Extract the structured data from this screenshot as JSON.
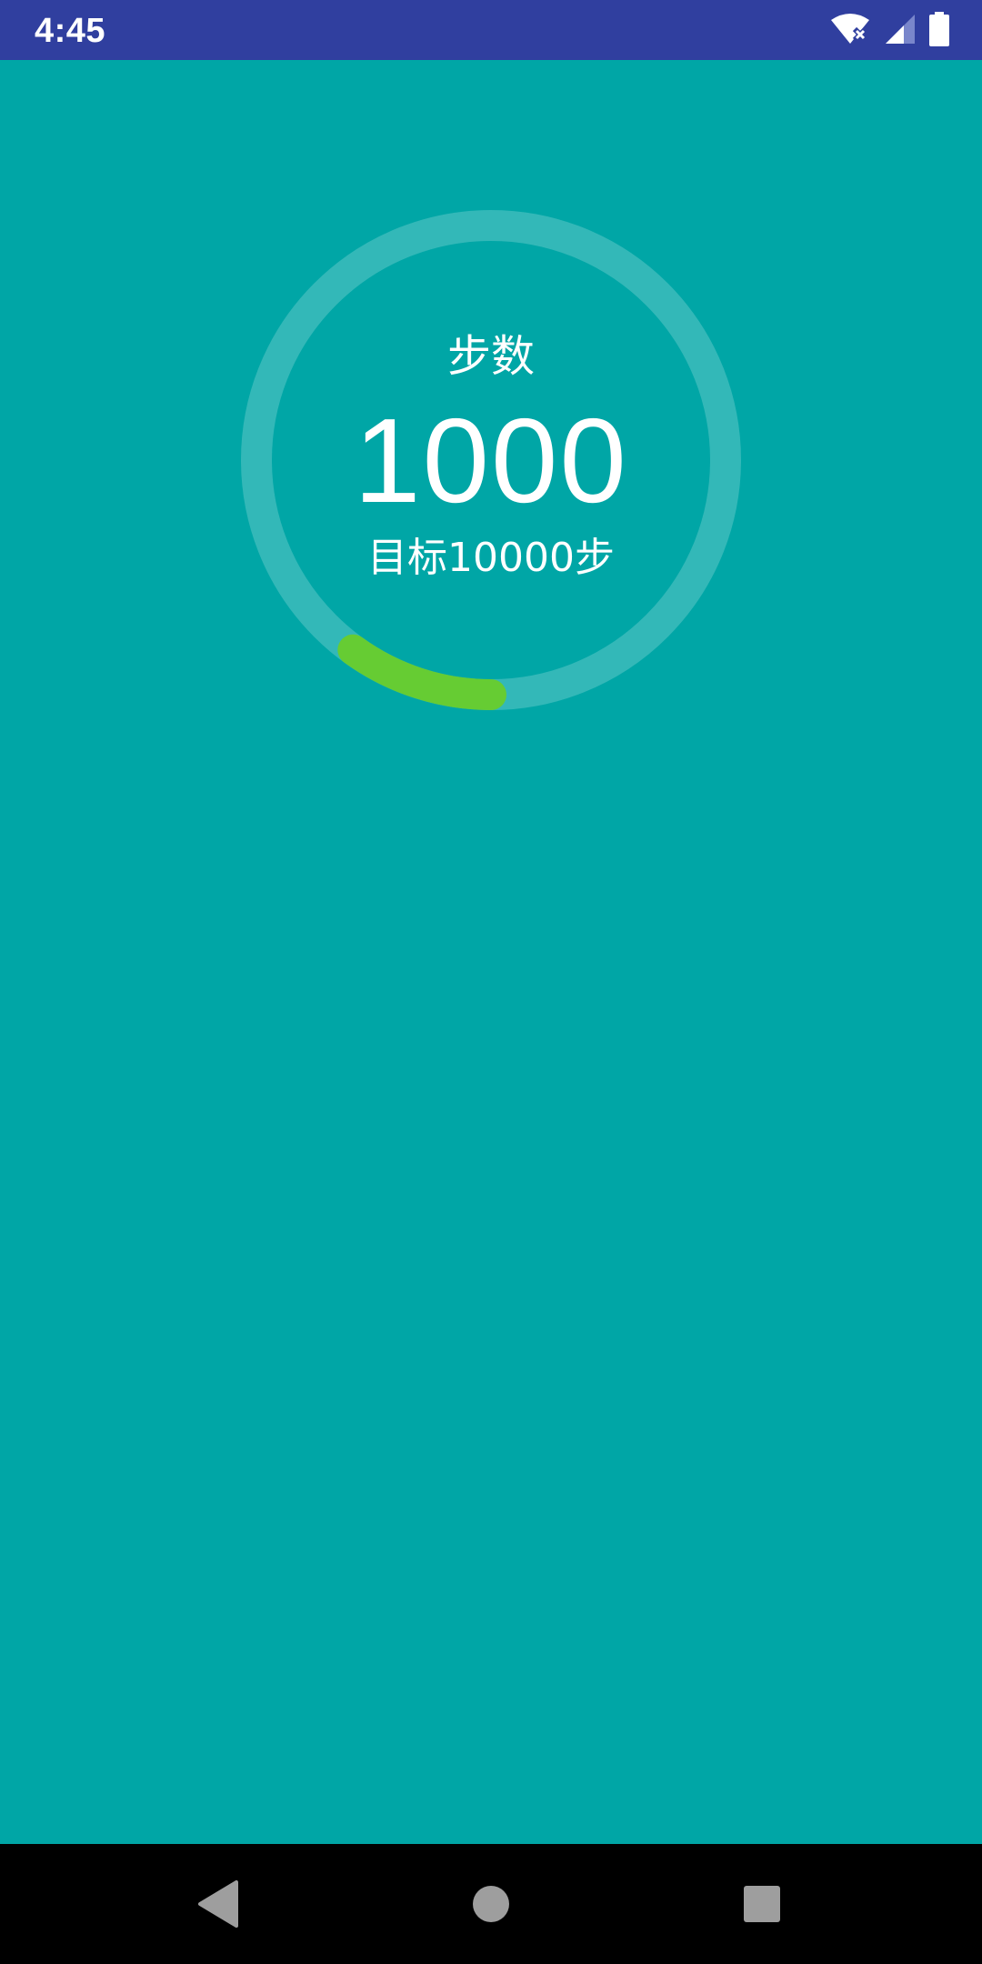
{
  "status_bar": {
    "time": "4:45",
    "icons": [
      "wifi-off-icon",
      "cellular-signal-icon",
      "battery-full-icon"
    ]
  },
  "step_counter": {
    "title": "步数",
    "value": "1000",
    "goal_text": "目标10000步",
    "progress_fraction": 0.1,
    "track_color": "#33B8B8",
    "progress_color": "#66CC33"
  },
  "nav_bar": {
    "icons": [
      "back-icon",
      "home-icon",
      "recents-icon"
    ]
  },
  "colors": {
    "status_bar_bg": "#303F9F",
    "content_bg": "#00A6A6",
    "nav_bar_bg": "#000000"
  }
}
